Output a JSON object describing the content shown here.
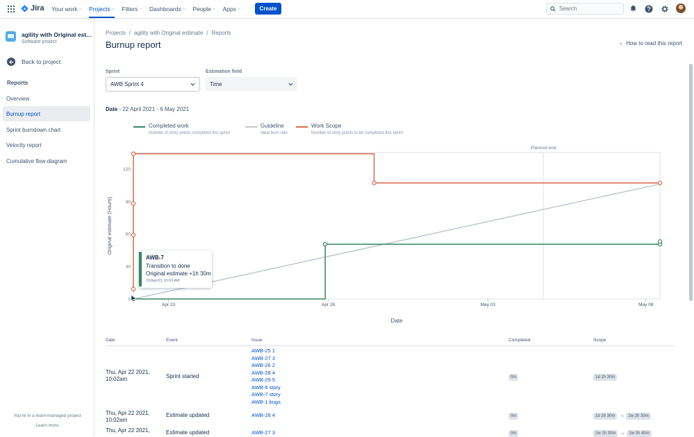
{
  "topbar": {
    "product": "Jira",
    "nav": [
      {
        "label": "Your work",
        "active": false
      },
      {
        "label": "Projects",
        "active": true
      },
      {
        "label": "Filters",
        "active": false
      },
      {
        "label": "Dashboards",
        "active": false
      },
      {
        "label": "People",
        "active": false
      },
      {
        "label": "Apps",
        "active": false
      }
    ],
    "create_label": "Create",
    "search_placeholder": "Search",
    "icons": [
      "notifications-icon",
      "help-icon",
      "settings-icon",
      "avatar"
    ],
    "accent": "#0052cc"
  },
  "sidebar": {
    "project_name": "agility with Original estimate",
    "project_type": "Software project",
    "back_label": "Back to project",
    "section": "Reports",
    "items": [
      {
        "label": "Overview",
        "active": false
      },
      {
        "label": "Burnup report",
        "active": true
      },
      {
        "label": "Sprint burndown chart",
        "active": false
      },
      {
        "label": "Velocity report",
        "active": false
      },
      {
        "label": "Cumulative flow diagram",
        "active": false
      }
    ],
    "footer_text": "You're in a team-managed project",
    "footer_link": "Learn more"
  },
  "main": {
    "breadcrumbs": [
      "Projects",
      "agility with Original estimate",
      "Reports"
    ],
    "title": "Burnup report",
    "help_link": "How to read this report",
    "sprint_label": "Sprint",
    "sprint_value": "AWB Sprint 4",
    "estimation_label": "Estimation field",
    "estimation_value": "Time",
    "date_label": "Date",
    "date_range": "22 April 2021 - 6 May 2021"
  },
  "chart_data": {
    "type": "line",
    "xlabel": "Date",
    "ylabel": "Original estimate (Hours)",
    "x_ticks": [
      "Apr 23",
      "Apr 28",
      "May 03",
      "May 08"
    ],
    "y_ticks": [
      0,
      30,
      60,
      90,
      120
    ],
    "ylim": [
      0,
      135
    ],
    "x_range_days": [
      0,
      14
    ],
    "planned_end_label": "Planned end",
    "planned_end_day": 10.9,
    "grid": false,
    "legend_position": "top-left",
    "series": [
      {
        "name": "Completed work",
        "description": "Number of story points completed this sprint",
        "color": "#36845f",
        "points": [
          [
            0,
            0
          ],
          [
            5.1,
            0
          ],
          [
            5.1,
            50.5
          ],
          [
            14,
            50.5
          ],
          [
            14,
            53
          ]
        ]
      },
      {
        "name": "Guideline",
        "description": "Ideal burn rate",
        "color": "#c1c7d0",
        "points": [
          [
            0,
            0
          ],
          [
            14,
            106
          ]
        ]
      },
      {
        "name": "Work Scope",
        "description": "Number of story points to be completed this sprint",
        "color": "#d9694b",
        "points": [
          [
            0,
            9
          ],
          [
            0,
            59
          ],
          [
            0,
            88
          ],
          [
            0,
            134
          ],
          [
            6.4,
            134
          ],
          [
            6.4,
            107
          ],
          [
            14,
            107
          ]
        ]
      }
    ],
    "markers": {
      "Completed work": [
        [
          0,
          0
        ],
        [
          5.1,
          50.5
        ],
        [
          14,
          50.5
        ],
        [
          14,
          53
        ]
      ],
      "Work Scope": [
        [
          0,
          9
        ],
        [
          0,
          59
        ],
        [
          0,
          88
        ],
        [
          0,
          134
        ],
        [
          6.4,
          107
        ],
        [
          14,
          107
        ]
      ]
    }
  },
  "tooltip": {
    "key": "AWB-7",
    "line1": "Transition to done",
    "line2": "Original estimate +1h 30m",
    "timestamp": "22/Apr/21 10:03 AM"
  },
  "table": {
    "headers": [
      "Date",
      "Event",
      "Issue",
      "Completed",
      "Scope"
    ],
    "rows": [
      {
        "date": "Thu, Apr 22 2021, 10:02am",
        "event": "Sprint started",
        "issues": [
          "AWB-25 1",
          "AWB-27 3",
          "AWB-26 2",
          "AWB-28 4",
          "AWB-29 5",
          "AWB-9 story",
          "AWB-7 story",
          "AWB-1 bugs"
        ],
        "completed": "0m",
        "scope_from": "1d 2h 30m",
        "scope_to": ""
      },
      {
        "date": "Thu, Apr 22 2021, 10:02am",
        "event": "Estimate updated",
        "issues": [
          "AWB-28 4"
        ],
        "completed": "0m",
        "scope_from": "1d 2h 30m",
        "scope_to": "2w 2h 30m"
      },
      {
        "date": "Thu, Apr 22 2021,",
        "event": "Estimate updated",
        "issues": [
          "AWB-27 3"
        ],
        "completed": "0m",
        "scope_from": "2w 2h 30m",
        "scope_to": "2w 2h 40m"
      }
    ]
  }
}
